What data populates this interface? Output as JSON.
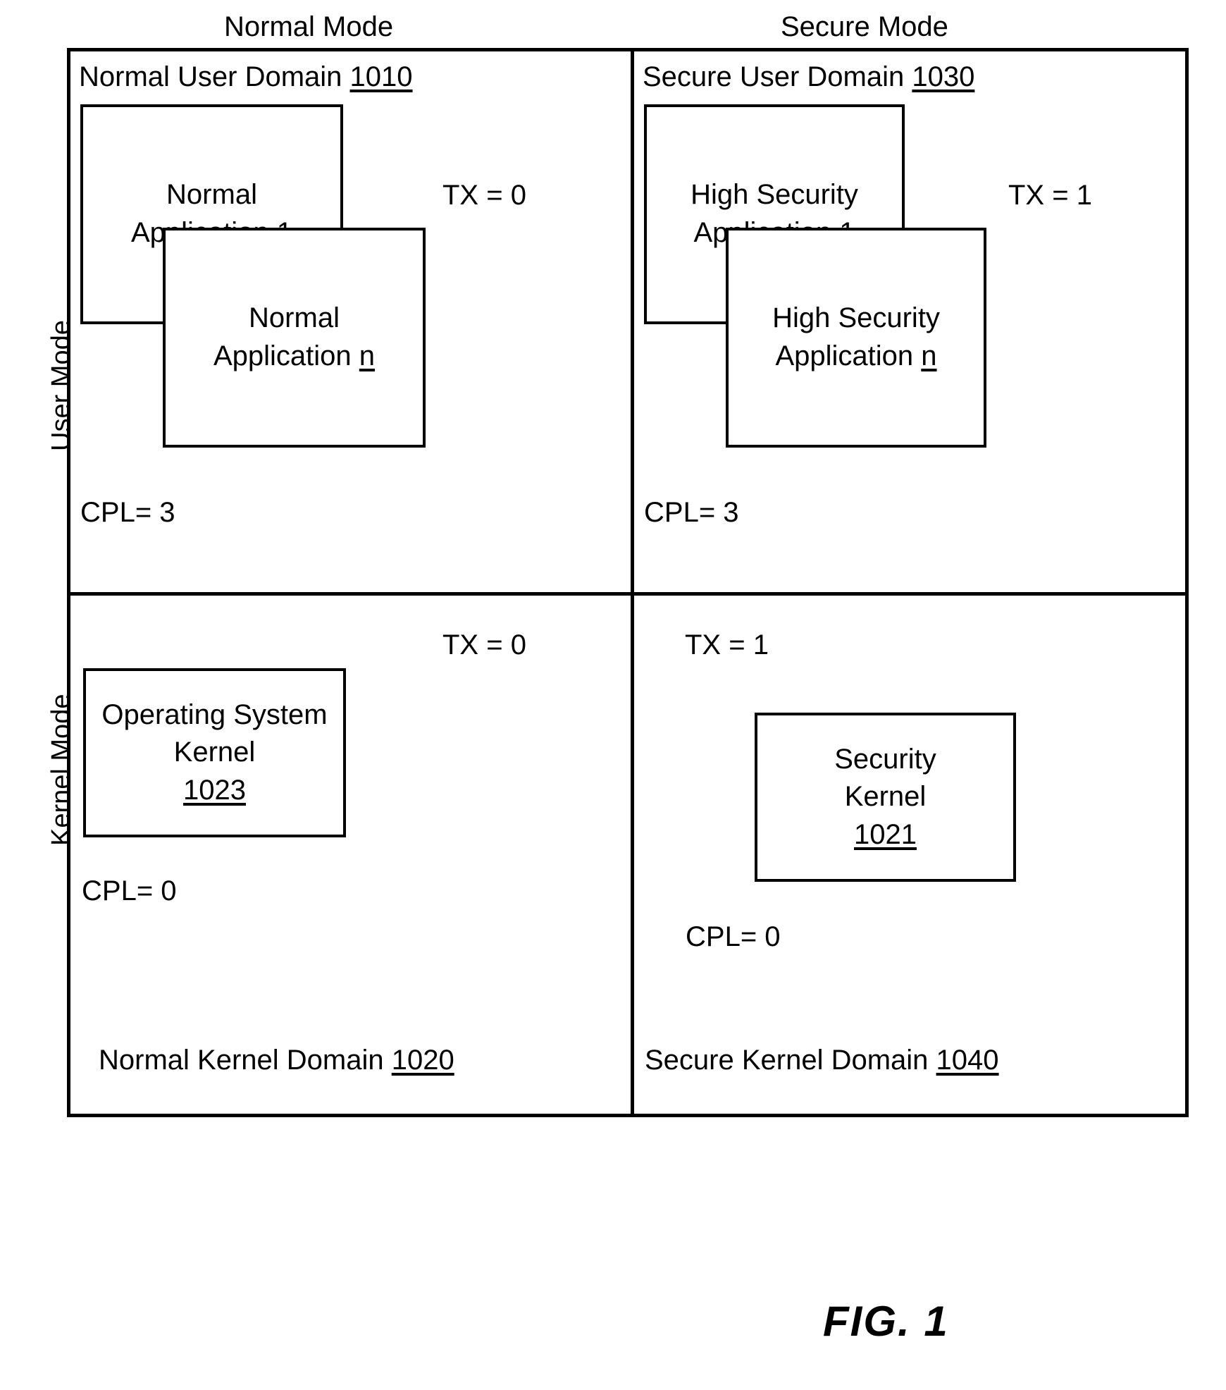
{
  "figure": {
    "caption": "FIG. 1"
  },
  "axis": {
    "columns": [
      {
        "id": "normal-mode",
        "label": "Normal Mode"
      },
      {
        "id": "secure-mode",
        "label": "Secure Mode"
      }
    ],
    "rows": [
      {
        "id": "user-mode",
        "label": "User Mode"
      },
      {
        "id": "kernel-mode",
        "label": "Kernel Mode"
      }
    ]
  },
  "quadrants": {
    "normal_user": {
      "title_text": "Normal User Domain",
      "title_ref": "1010",
      "tx": "TX = 0",
      "cpl": "CPL= 3",
      "boxes": [
        {
          "line1": "Normal",
          "line2": "Application",
          "ref": "1"
        },
        {
          "line1": "Normal",
          "line2": "Application",
          "ref": "n"
        }
      ]
    },
    "secure_user": {
      "title_text": "Secure User Domain",
      "title_ref": "1030",
      "tx": "TX = 1",
      "cpl": "CPL= 3",
      "boxes": [
        {
          "line1": "High Security",
          "line2": "Application",
          "ref": "1"
        },
        {
          "line1": "High Security",
          "line2": "Application",
          "ref": "n"
        }
      ]
    },
    "normal_kernel": {
      "title_text": "Normal Kernel Domain",
      "title_ref": "1020",
      "tx": "TX = 0",
      "cpl": "CPL= 0",
      "boxes": [
        {
          "line1": "Operating System",
          "line2": "Kernel",
          "ref": "1023"
        }
      ]
    },
    "secure_kernel": {
      "title_text": "Secure Kernel Domain",
      "title_ref": "1040",
      "tx": "TX = 1",
      "cpl": "CPL= 0",
      "boxes": [
        {
          "line1": "Security",
          "line2": "Kernel",
          "ref": "1021"
        }
      ]
    }
  }
}
